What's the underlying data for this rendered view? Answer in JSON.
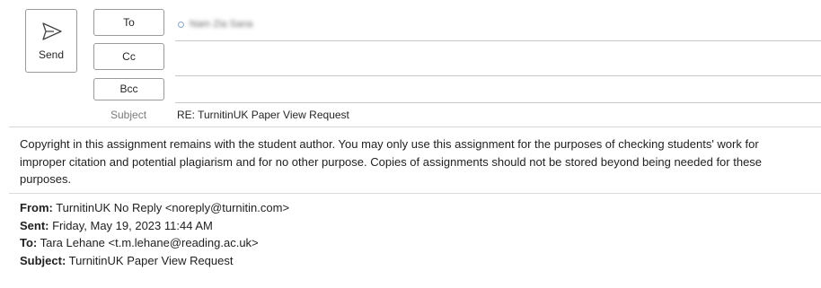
{
  "compose": {
    "send_label": "Send",
    "to_label": "To",
    "cc_label": "Cc",
    "bcc_label": "Bcc",
    "to_recipient": "Nam Zia Sana",
    "subject_label": "Subject",
    "subject_value": "RE: TurnitinUK Paper View Request"
  },
  "body": {
    "text": "Copyright in this assignment remains with the student author. You may only use this assignment for the purposes of checking students' work for improper citation and potential plagiarism and for no other purpose. Copies of assignments should not be stored beyond being needed for these purposes."
  },
  "quoted": {
    "from_label": "From:",
    "from_value": " TurnitinUK No Reply <noreply@turnitin.com>",
    "sent_label": "Sent:",
    "sent_value": " Friday, May 19, 2023 11:44 AM",
    "to_label": "To:",
    "to_value": " Tara Lehane <t.m.lehane@reading.ac.uk>",
    "subject_label": "Subject:",
    "subject_value": " TurnitinUK Paper View Request"
  },
  "icons": {
    "send": "send-paper-plane-icon",
    "presence": "presence-status-icon"
  }
}
